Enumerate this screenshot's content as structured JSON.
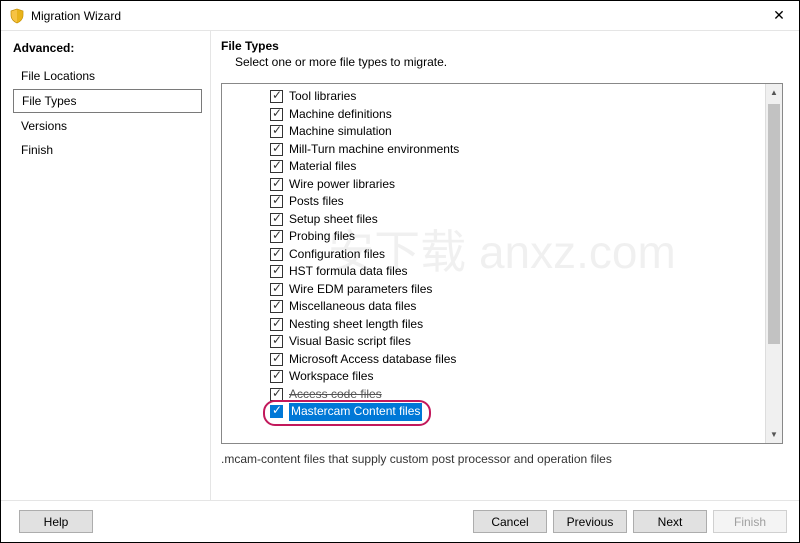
{
  "window": {
    "title": "Migration Wizard",
    "close_glyph": "✕"
  },
  "sidebar": {
    "heading": "Advanced:",
    "items": [
      {
        "label": "File Locations",
        "selected": false,
        "highlighted": false
      },
      {
        "label": "File Types",
        "selected": true,
        "highlighted": true
      },
      {
        "label": "Versions",
        "selected": false,
        "highlighted": false
      },
      {
        "label": "Finish",
        "selected": false,
        "highlighted": false
      }
    ]
  },
  "main": {
    "heading": "File Types",
    "subtitle": "Select one or more file types to migrate.",
    "file_types": [
      {
        "label": "Tool libraries",
        "checked": true
      },
      {
        "label": "Machine definitions",
        "checked": true
      },
      {
        "label": "Machine simulation",
        "checked": true
      },
      {
        "label": "Mill-Turn machine environments",
        "checked": true
      },
      {
        "label": "Material files",
        "checked": true
      },
      {
        "label": "Wire power libraries",
        "checked": true
      },
      {
        "label": "Posts files",
        "checked": true
      },
      {
        "label": "Setup sheet files",
        "checked": true
      },
      {
        "label": "Probing files",
        "checked": true
      },
      {
        "label": "Configuration files",
        "checked": true
      },
      {
        "label": "HST formula data files",
        "checked": true
      },
      {
        "label": "Wire EDM parameters files",
        "checked": true
      },
      {
        "label": "Miscellaneous data files",
        "checked": true
      },
      {
        "label": "Nesting sheet length files",
        "checked": true
      },
      {
        "label": "Visual Basic script files",
        "checked": true
      },
      {
        "label": "Microsoft Access database files",
        "checked": true
      },
      {
        "label": "Workspace files",
        "checked": true
      },
      {
        "label": "Access code files",
        "checked": true,
        "struck": true
      },
      {
        "label": "Mastercam Content files",
        "checked": true,
        "selected": true,
        "highlighted": true
      }
    ],
    "description": ".mcam-content files that supply custom post processor and operation files"
  },
  "footer": {
    "help": "Help",
    "cancel": "Cancel",
    "previous": "Previous",
    "next": "Next",
    "finish": "Finish",
    "finish_disabled": true
  },
  "watermark": "安下载  anxz.com"
}
